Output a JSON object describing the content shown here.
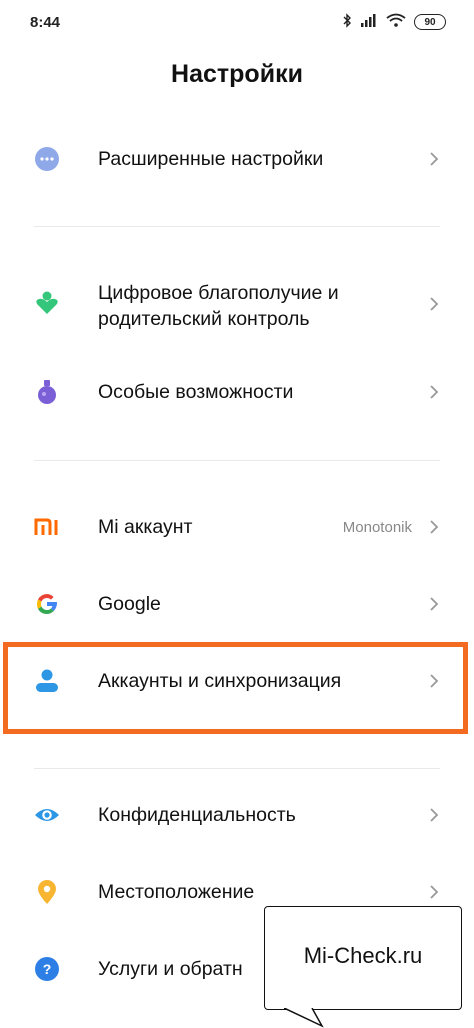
{
  "status_bar": {
    "time": "8:44",
    "battery": "90"
  },
  "header": {
    "title": "Настройки"
  },
  "sections": [
    {
      "items": [
        {
          "label": "Расширенные настройки",
          "icon": "more-dots-icon"
        }
      ]
    },
    {
      "items": [
        {
          "label_line1": "Цифровое благополучие и",
          "label_line2": "родительский контроль",
          "icon": "digital-wellbeing-icon"
        },
        {
          "label": "Особые возможности",
          "icon": "accessibility-flask-icon"
        }
      ]
    },
    {
      "items": [
        {
          "label": "Mi аккаунт",
          "value": "Monotonik",
          "icon": "mi-logo-icon"
        },
        {
          "label": "Google",
          "icon": "google-logo-icon"
        },
        {
          "label": "Аккаунты и синхронизация",
          "icon": "account-person-icon",
          "highlighted": true
        }
      ]
    },
    {
      "items": [
        {
          "label": "Конфиденциальность",
          "icon": "privacy-eye-icon"
        },
        {
          "label": "Местоположение",
          "icon": "location-pin-icon"
        },
        {
          "label": "Услуги и обратн",
          "icon": "help-question-icon"
        }
      ]
    }
  ],
  "callout": {
    "text": "Mi-Check.ru"
  },
  "colors": {
    "highlight_border": "#f26b21",
    "accent_blue": "#2d97e6",
    "mi_orange": "#ff6900"
  }
}
